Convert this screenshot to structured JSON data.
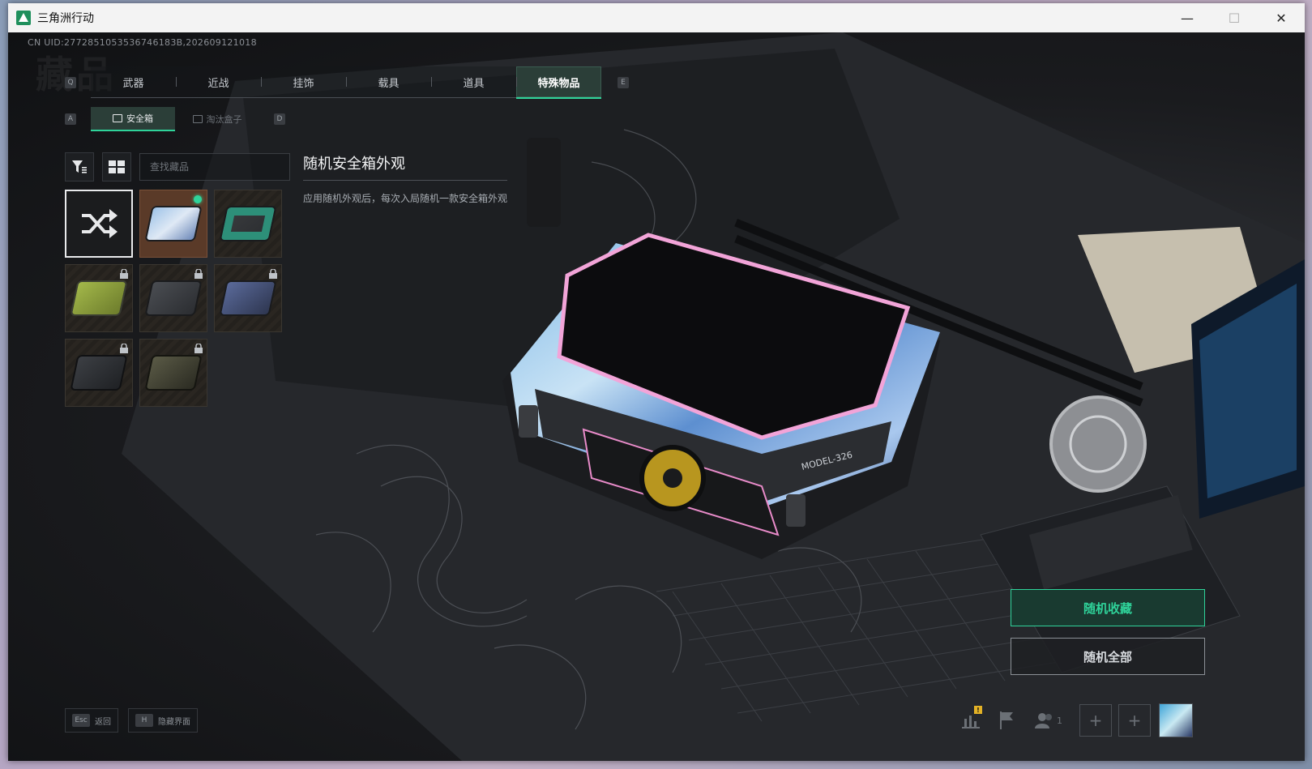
{
  "window": {
    "title": "三角洲行动",
    "minimize": "—",
    "maximize": "☐",
    "close": "✕"
  },
  "uid": "CN UID:2772851053536746183B,202609121018",
  "page_title": "藏品",
  "tabs": {
    "key_prev": "Q",
    "key_next": "E",
    "items": [
      "武器",
      "近战",
      "挂饰",
      "载具",
      "道具",
      "特殊物品"
    ],
    "active_index": 5
  },
  "subtabs": {
    "key_prev": "A",
    "key_next": "D",
    "items": [
      "安全箱",
      "淘汰盒子"
    ],
    "active_index": 0
  },
  "search": {
    "placeholder": "查找藏品"
  },
  "detail": {
    "title": "随机安全箱外观",
    "description": "应用随机外观后，每次入局随机一款安全箱外观"
  },
  "model_label": "MODEL-326",
  "actions": {
    "random_favorite": "随机收藏",
    "random_all": "随机全部"
  },
  "footer": {
    "back_key": "Esc",
    "back_label": "返回",
    "hide_key": "H",
    "hide_label": "隐藏界面"
  },
  "hud": {
    "party_count": "1",
    "warning": "!"
  },
  "colors": {
    "accent": "#2fd39a",
    "active_tab_bg": "#2b3e38"
  }
}
